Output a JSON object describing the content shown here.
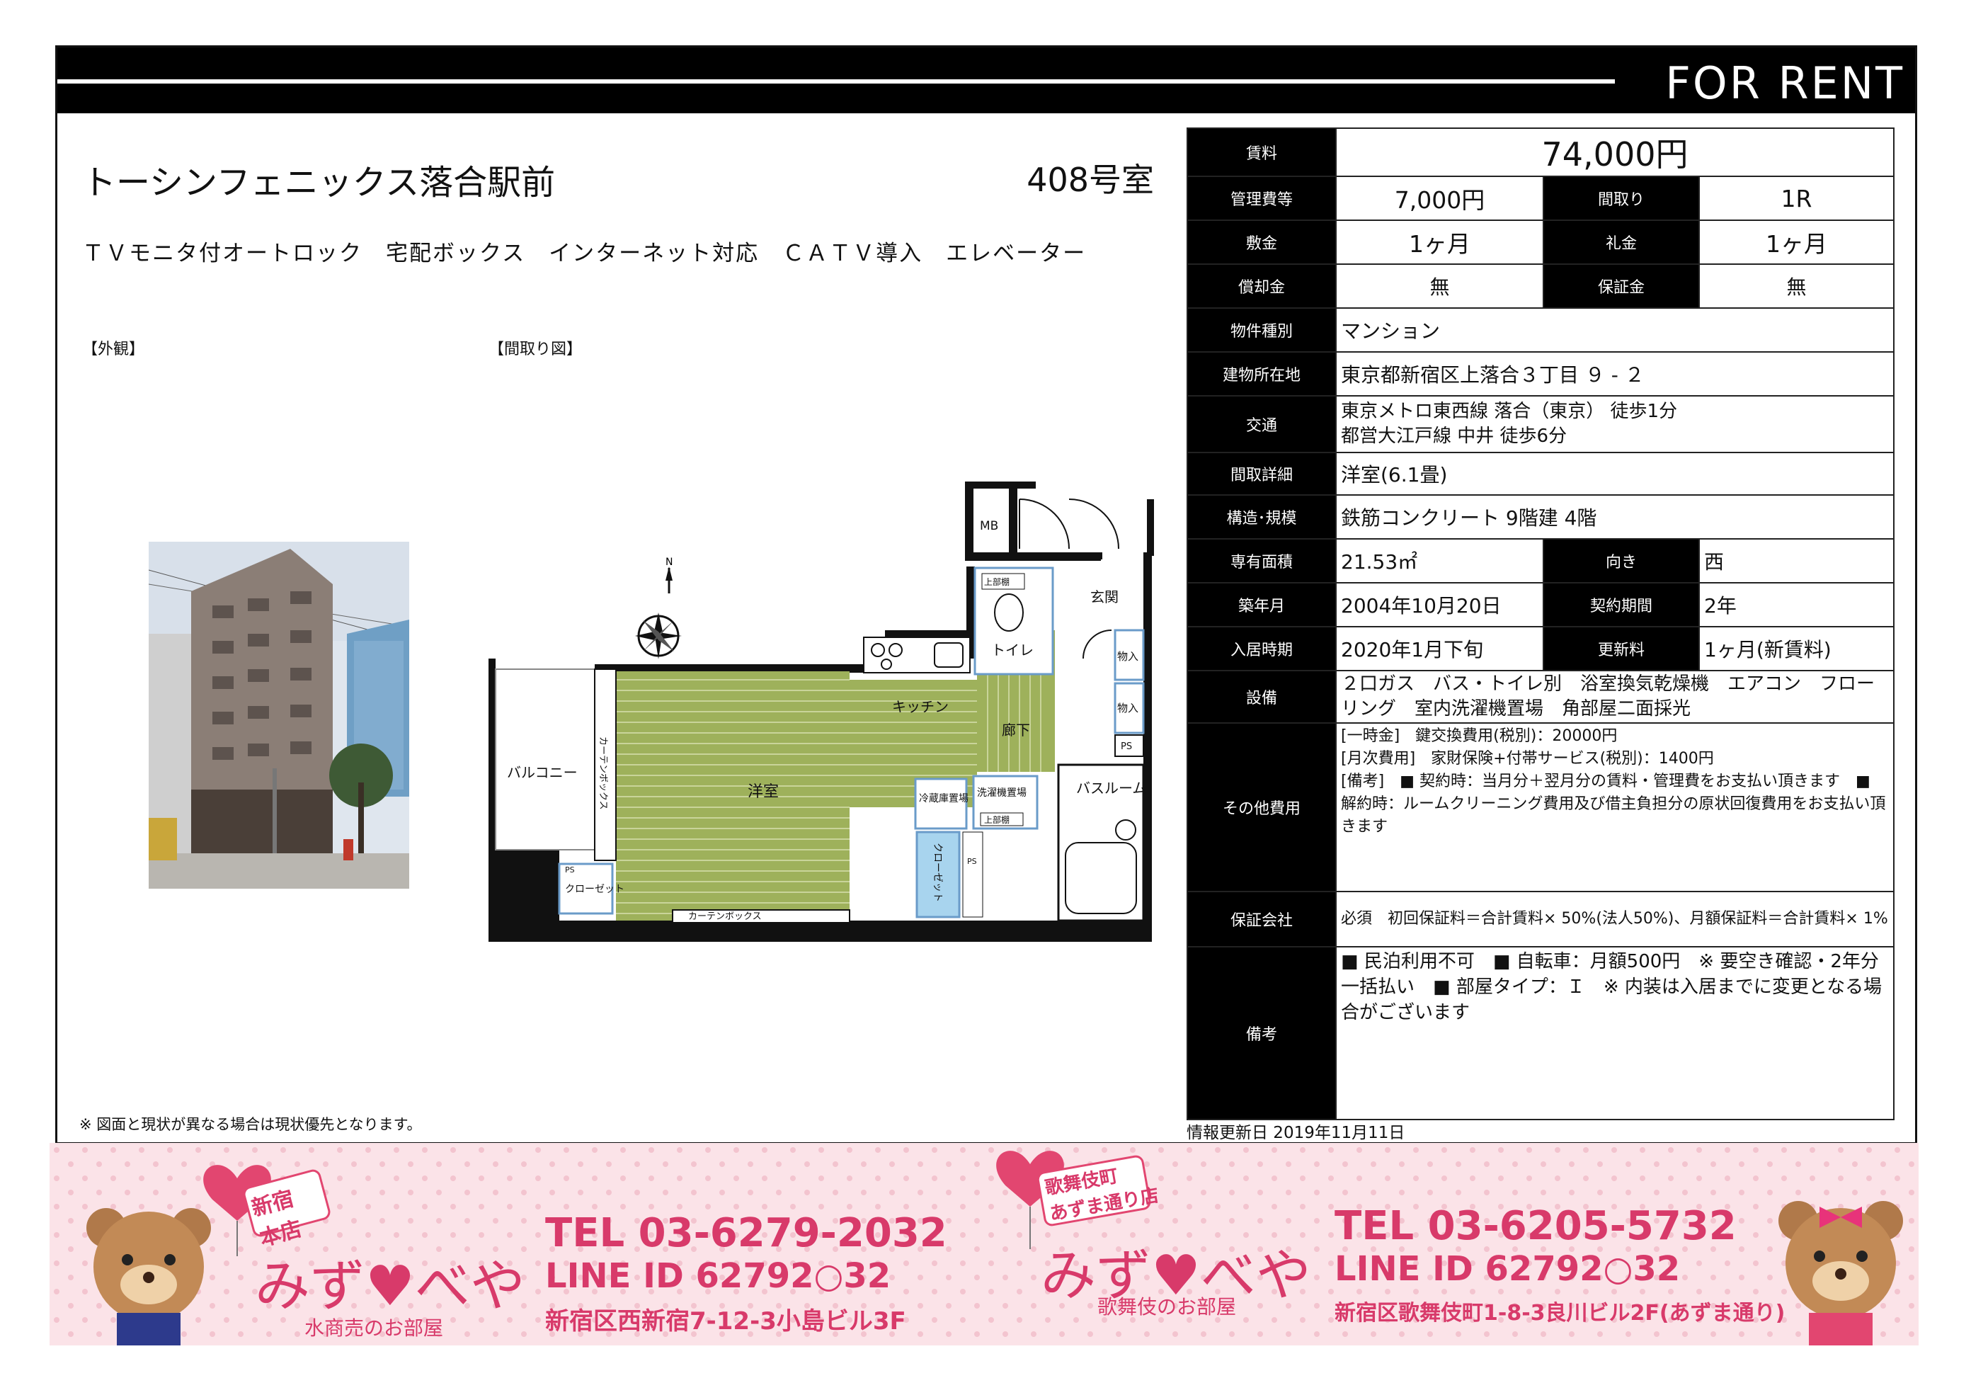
{
  "header": {
    "for_rent": "FOR RENT"
  },
  "property": {
    "name": "トーシンフェニックス落合駅前",
    "room": "408号室",
    "features": "ＴＶモニタ付オートロック　宅配ボックス　インターネット対応　ＣＡＴＶ導入　エレベーター"
  },
  "photos": {
    "exterior_label": "【外観】",
    "floorplan_label": "【間取り図】"
  },
  "floorplan": {
    "mb": "MB",
    "entrance": "玄関",
    "upper_shelf_1": "上部棚",
    "toilet": "トイレ",
    "kitchen": "キッチン",
    "hallway": "廊下",
    "storage_1": "物入",
    "storage_2": "物入",
    "ps": "PS",
    "balcony": "バルコニー",
    "curtain_box_v": "カーテンボックス",
    "western_room": "洋室",
    "fridge": "冷蔵庫置場",
    "washer": "洗濯機置場",
    "upper_shelf_2": "上部棚",
    "bathroom": "バスルーム",
    "closet_1": "クローゼット",
    "closet_2": "クローゼット",
    "ps2": "PS",
    "ps3": "PS",
    "curtain_box_h": "カーテンボックス"
  },
  "specs": {
    "rent_label": "賃料",
    "rent": "74,000円",
    "mgmt_label": "管理費等",
    "mgmt": "7,000円",
    "layout_label": "間取り",
    "layout": "1R",
    "deposit_label": "敷金",
    "deposit": "1ヶ月",
    "key_money_label": "礼金",
    "key_money": "1ヶ月",
    "amortization_label": "償却金",
    "amortization": "無",
    "guarantee_money_label": "保証金",
    "guarantee_money": "無",
    "type_label": "物件種別",
    "type": "マンション",
    "address_label": "建物所在地",
    "address": "東京都新宿区上落合３丁目 ９ - ２",
    "transport_label": "交通",
    "transport_1": "東京メトロ東西線 落合（東京） 徒歩1分",
    "transport_2": "都営大江戸線 中井 徒歩6分",
    "layout_detail_label": "間取詳細",
    "layout_detail": "洋室(6.1畳)",
    "structure_label": "構造･規模",
    "structure": "鉄筋コンクリート 9階建 4階",
    "area_label": "専有面積",
    "area": "21.53㎡",
    "direction_label": "向き",
    "direction": "西",
    "built_label": "築年月",
    "built": "2004年10月20日",
    "term_label": "契約期間",
    "term": "2年",
    "move_in_label": "入居時期",
    "move_in": "2020年1月下旬",
    "renewal_label": "更新料",
    "renewal": "1ヶ月(新賃料)",
    "equipment_label": "設備",
    "equipment": "２口ガス　バス・トイレ別　浴室換気乾燥機　エアコン　フローリング　室内洗濯機置場　角部屋二面採光",
    "other_costs_label": "その他費用",
    "other_costs_1": "[一時金]　鍵交換費用(税別)：20000円",
    "other_costs_2": "[月次費用]　家財保険+付帯サービス(税別)：1400円",
    "other_costs_3": "[備考]　■ 契約時：当月分＋翌月分の賃料・管理費をお支払い頂きます　■ 解約時：ルームクリーニング費用及び借主負担分の原状回復費用をお支払い頂きます",
    "guarantor_label": "保証会社",
    "guarantor": "必須　初回保証料＝合計賃料× 50%(法人50%)、月額保証料＝合計賃料× 1%",
    "notes_label": "備考",
    "notes": "■ 民泊利用不可　■ 自転車：月額500円　※ 要空き確認・2年分一括払い　■ 部屋タイプ：Ｉ　※ 内装は入居までに変更となる場合がございます"
  },
  "footer": {
    "disclaimer": "※ 図面と現状が異なる場合は現状優先となります。",
    "updated": "情報更新日 2019年11月11日"
  },
  "banner": {
    "store1_tag_1": "新宿",
    "store1_tag_2": "本店",
    "brand": "みず♥べや",
    "store1_sub": "水商売のお部屋",
    "store1_tel": "TEL 03-6279-2032",
    "store1_line": "LINE ID 62792○32",
    "store1_address": "新宿区西新宿7-12-3小島ビル3F",
    "store2_tag_1": "歌舞伎町",
    "store2_tag_2": "あずま通り店",
    "store2_sub": "歌舞伎のお部屋",
    "store2_tel": "TEL 03-6205-5732",
    "store2_line": "LINE ID 62792○32",
    "store2_address": "新宿区歌舞伎町1-8-3良川ビル2F(あずま通り)"
  }
}
